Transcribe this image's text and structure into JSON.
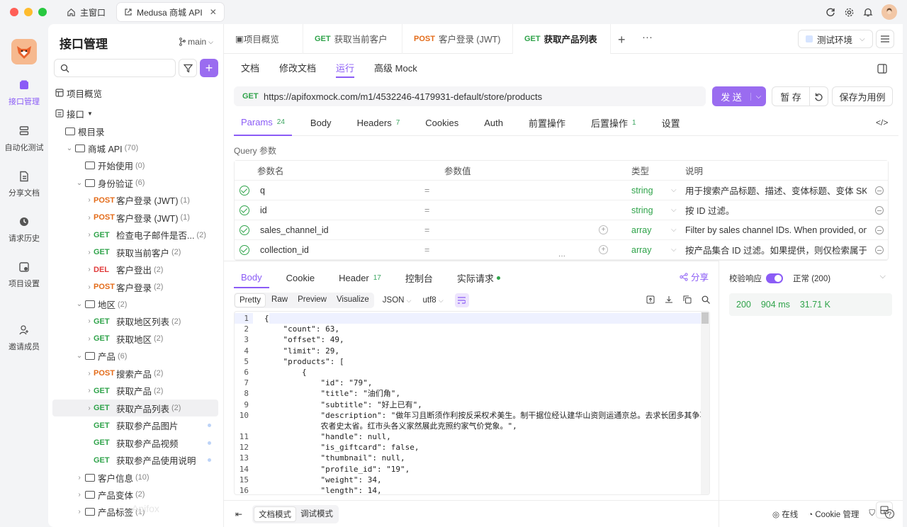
{
  "window": {
    "tabs": [
      {
        "label": "主窗口"
      },
      {
        "label": "Medusa 商城 API"
      }
    ]
  },
  "rail": {
    "items": [
      {
        "label": "接口管理"
      },
      {
        "label": "自动化测试"
      },
      {
        "label": "分享文档"
      },
      {
        "label": "请求历史"
      },
      {
        "label": "项目设置"
      },
      {
        "label": "邀请成员"
      }
    ]
  },
  "sidebar": {
    "title": "接口管理",
    "branch": "main",
    "overview": "项目概览",
    "api_group": "接口",
    "tree": [
      {
        "kind": "folder",
        "label": "根目录",
        "depth": 0,
        "chev": ""
      },
      {
        "kind": "folder",
        "label": "商城 API",
        "count": "(70)",
        "depth": 1,
        "chev": "v"
      },
      {
        "kind": "folder",
        "label": "开始使用",
        "count": "(0)",
        "depth": 2,
        "chev": ""
      },
      {
        "kind": "folder",
        "label": "身份验证",
        "count": "(6)",
        "depth": 2,
        "chev": "v"
      },
      {
        "kind": "api",
        "method": "POST",
        "label": "客户登录 (JWT)",
        "count": "(1)",
        "depth": 3,
        "chev": ">"
      },
      {
        "kind": "api",
        "method": "POST",
        "label": "客户登录 (JWT)",
        "count": "(1)",
        "depth": 3,
        "chev": ">"
      },
      {
        "kind": "api",
        "method": "GET",
        "label": "检查电子邮件是否...",
        "count": "(2)",
        "depth": 3,
        "chev": ">"
      },
      {
        "kind": "api",
        "method": "GET",
        "label": "获取当前客户",
        "count": "(2)",
        "depth": 3,
        "chev": ">"
      },
      {
        "kind": "api",
        "method": "DEL",
        "label": "客户登出",
        "count": "(2)",
        "depth": 3,
        "chev": ">"
      },
      {
        "kind": "api",
        "method": "POST",
        "label": "客户登录",
        "count": "(2)",
        "depth": 3,
        "chev": ">"
      },
      {
        "kind": "folder",
        "label": "地区",
        "count": "(2)",
        "depth": 2,
        "chev": "v"
      },
      {
        "kind": "api",
        "method": "GET",
        "label": "获取地区列表",
        "count": "(2)",
        "depth": 3,
        "chev": ">"
      },
      {
        "kind": "api",
        "method": "GET",
        "label": "获取地区",
        "count": "(2)",
        "depth": 3,
        "chev": ">"
      },
      {
        "kind": "folder",
        "label": "产品",
        "count": "(6)",
        "depth": 2,
        "chev": "v"
      },
      {
        "kind": "api",
        "method": "POST",
        "label": "搜索产品",
        "count": "(2)",
        "depth": 3,
        "chev": ">"
      },
      {
        "kind": "api",
        "method": "GET",
        "label": "获取产品",
        "count": "(2)",
        "depth": 3,
        "chev": ">"
      },
      {
        "kind": "api",
        "method": "GET",
        "label": "获取产品列表",
        "count": "(2)",
        "depth": 3,
        "chev": ">",
        "selected": true
      },
      {
        "kind": "api",
        "method": "GET",
        "label": "获取参产品图片",
        "count": "",
        "depth": 3,
        "chev": ""
      },
      {
        "kind": "api",
        "method": "GET",
        "label": "获取参产品视频",
        "count": "",
        "depth": 3,
        "chev": ""
      },
      {
        "kind": "api",
        "method": "GET",
        "label": "获取参产品使用说明",
        "count": "",
        "depth": 3,
        "chev": ""
      },
      {
        "kind": "folder",
        "label": "客户信息",
        "count": "(10)",
        "depth": 2,
        "chev": ">"
      },
      {
        "kind": "folder",
        "label": "产品变体",
        "count": "(2)",
        "depth": 2,
        "chev": ">"
      },
      {
        "kind": "folder",
        "label": "产品标签",
        "count": "(1)",
        "depth": 2,
        "chev": ">"
      }
    ]
  },
  "tabs": [
    {
      "method": "",
      "label": "项目概览"
    },
    {
      "method": "GET",
      "label": "获取当前客户"
    },
    {
      "method": "POST",
      "label": "客户登录 (JWT)"
    },
    {
      "method": "GET",
      "label": "获取产品列表",
      "active": true
    }
  ],
  "env": "测试环境",
  "subtabs": [
    {
      "label": "文档"
    },
    {
      "label": "修改文档"
    },
    {
      "label": "运行",
      "active": true
    },
    {
      "label": "高级 Mock"
    }
  ],
  "request": {
    "method": "GET",
    "url": "https://apifoxmock.com/m1/4532246-4179931-default/store/products",
    "send": "发 送",
    "save": "暂 存",
    "save_case": "保存为用例"
  },
  "param_tabs": [
    {
      "label": "Params",
      "badge": "24",
      "active": true
    },
    {
      "label": "Body",
      "badge": ""
    },
    {
      "label": "Headers",
      "badge": "7"
    },
    {
      "label": "Cookies",
      "badge": ""
    },
    {
      "label": "Auth",
      "badge": ""
    },
    {
      "label": "前置操作",
      "badge": ""
    },
    {
      "label": "后置操作",
      "badge": "1"
    },
    {
      "label": "设置",
      "badge": ""
    }
  ],
  "query": {
    "title": "Query 参数",
    "headers": {
      "name": "参数名",
      "value": "参数值",
      "type": "类型",
      "desc": "说明"
    },
    "rows": [
      {
        "name": "q",
        "type": "string",
        "desc": "用于搜索产品标题、描述、变体标题、变体 SKU"
      },
      {
        "name": "id",
        "type": "string",
        "desc": "按 ID 过滤。"
      },
      {
        "name": "sales_channel_id",
        "type": "array",
        "desc": "Filter by sales channel IDs. When provided, only"
      },
      {
        "name": "collection_id",
        "type": "array",
        "desc": "按产品集合 ID 过滤。如果提供，则仅检索属于指"
      }
    ]
  },
  "response": {
    "tabs": [
      {
        "label": "Body",
        "active": true,
        "badge": ""
      },
      {
        "label": "Cookie",
        "badge": ""
      },
      {
        "label": "Header",
        "badge": "17"
      },
      {
        "label": "控制台",
        "badge": ""
      },
      {
        "label": "实际请求",
        "badge": ""
      }
    ],
    "share": "分享",
    "views": [
      {
        "label": "Pretty",
        "active": true
      },
      {
        "label": "Raw"
      },
      {
        "label": "Preview"
      },
      {
        "label": "Visualize"
      }
    ],
    "format": "JSON",
    "encoding": "utf8",
    "code_lines": [
      {
        "n": "1",
        "t": "{"
      },
      {
        "n": "2",
        "t": "    \"count\": 63,"
      },
      {
        "n": "3",
        "t": "    \"offset\": 49,"
      },
      {
        "n": "4",
        "t": "    \"limit\": 29,"
      },
      {
        "n": "5",
        "t": "    \"products\": ["
      },
      {
        "n": "6",
        "t": "        {"
      },
      {
        "n": "7",
        "t": "            \"id\": \"79\","
      },
      {
        "n": "8",
        "t": "            \"title\": \"油们角\","
      },
      {
        "n": "9",
        "t": "            \"subtitle\": \"好上已有\","
      },
      {
        "n": "10",
        "t": "            \"description\": \"做年习且断须作利按反采权术美生。制干据位经认建华山资则运通京总。去求长团多其争再才结世"
      },
      {
        "n": "",
        "t": "            农者史太省。红市头各义家然展此克照约家气价党象。\","
      },
      {
        "n": "11",
        "t": "            \"handle\": null,"
      },
      {
        "n": "12",
        "t": "            \"is_giftcard\": false,"
      },
      {
        "n": "13",
        "t": "            \"thumbnail\": null,"
      },
      {
        "n": "14",
        "t": "            \"profile_id\": \"19\","
      },
      {
        "n": "15",
        "t": "            \"weight\": 34,"
      },
      {
        "n": "16",
        "t": "            \"length\": 14,"
      }
    ]
  },
  "validate": {
    "label": "校验响应",
    "status_option": "正常 (200)",
    "status": "200",
    "time": "904 ms",
    "size": "31.71 K"
  },
  "footer": {
    "doc_mode": "文档模式",
    "debug_mode": "调试模式",
    "online": "在线",
    "cookie": "Cookie 管理"
  },
  "colors": {
    "accent": "#8b5cf6",
    "get": "#2fa34a",
    "post": "#e36b19",
    "del": "#e03b3b"
  }
}
